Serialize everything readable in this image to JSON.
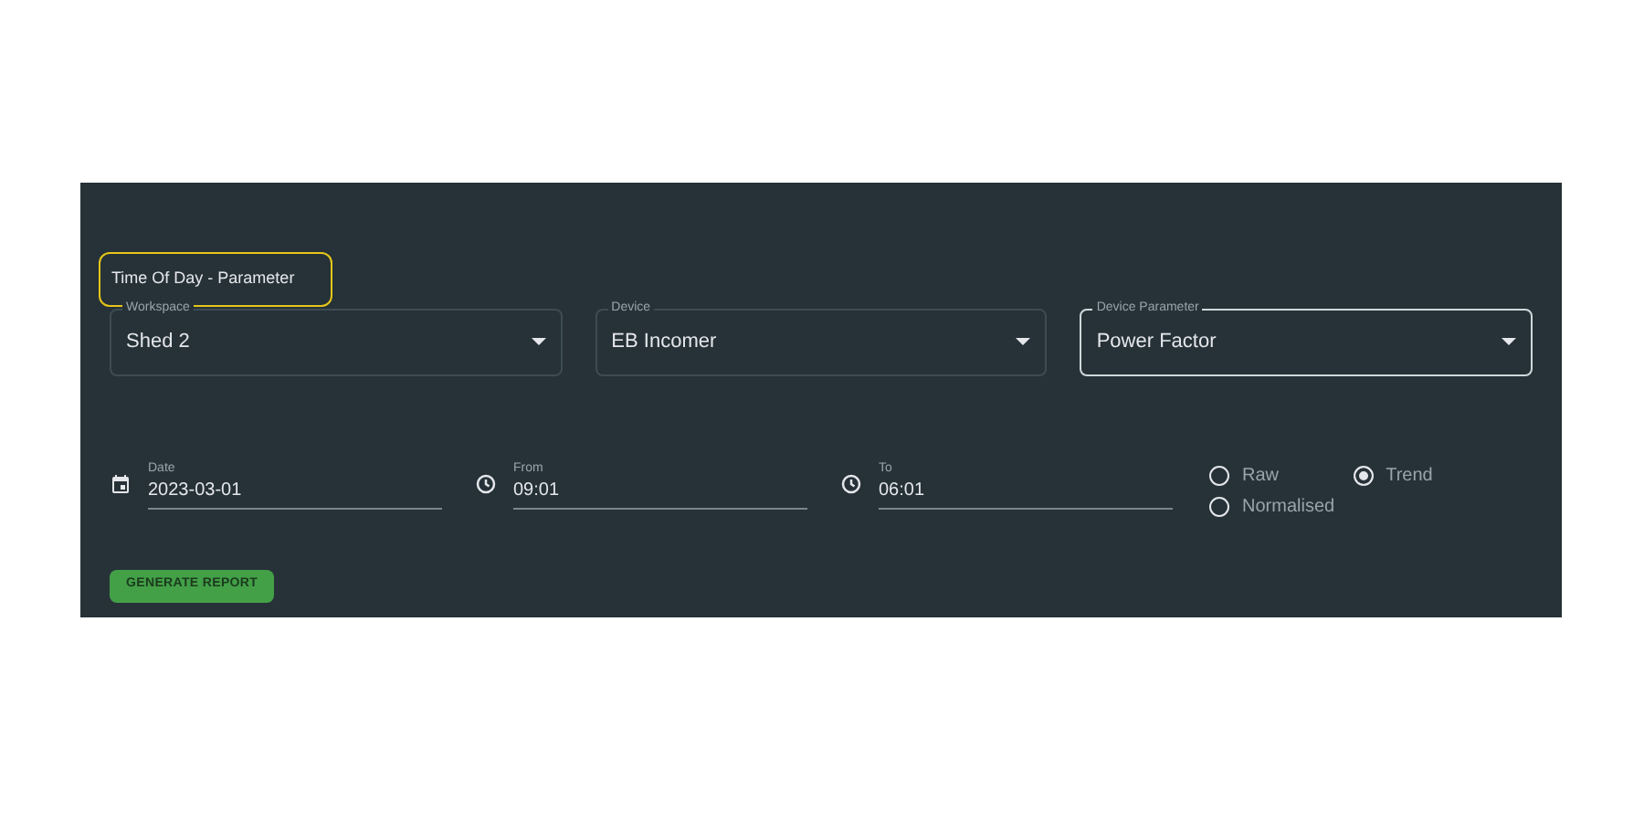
{
  "title": "Time Of Day - Parameter",
  "selects": [
    {
      "label": "Workspace",
      "value": "Shed 2",
      "focused": false
    },
    {
      "label": "Device",
      "value": "EB Incomer",
      "focused": false
    },
    {
      "label": "Device Parameter",
      "value": "Power Factor",
      "focused": true
    }
  ],
  "inputs": [
    {
      "kind": "date",
      "label": "Date",
      "value": "2023-03-01"
    },
    {
      "kind": "time",
      "label": "From",
      "value": "09:01"
    },
    {
      "kind": "time",
      "label": "To",
      "value": "06:01"
    }
  ],
  "radios": [
    {
      "label": "Raw",
      "selected": false
    },
    {
      "label": "Trend",
      "selected": true
    },
    {
      "label": "Normalised",
      "selected": false
    }
  ],
  "button": "GENERATE REPORT"
}
